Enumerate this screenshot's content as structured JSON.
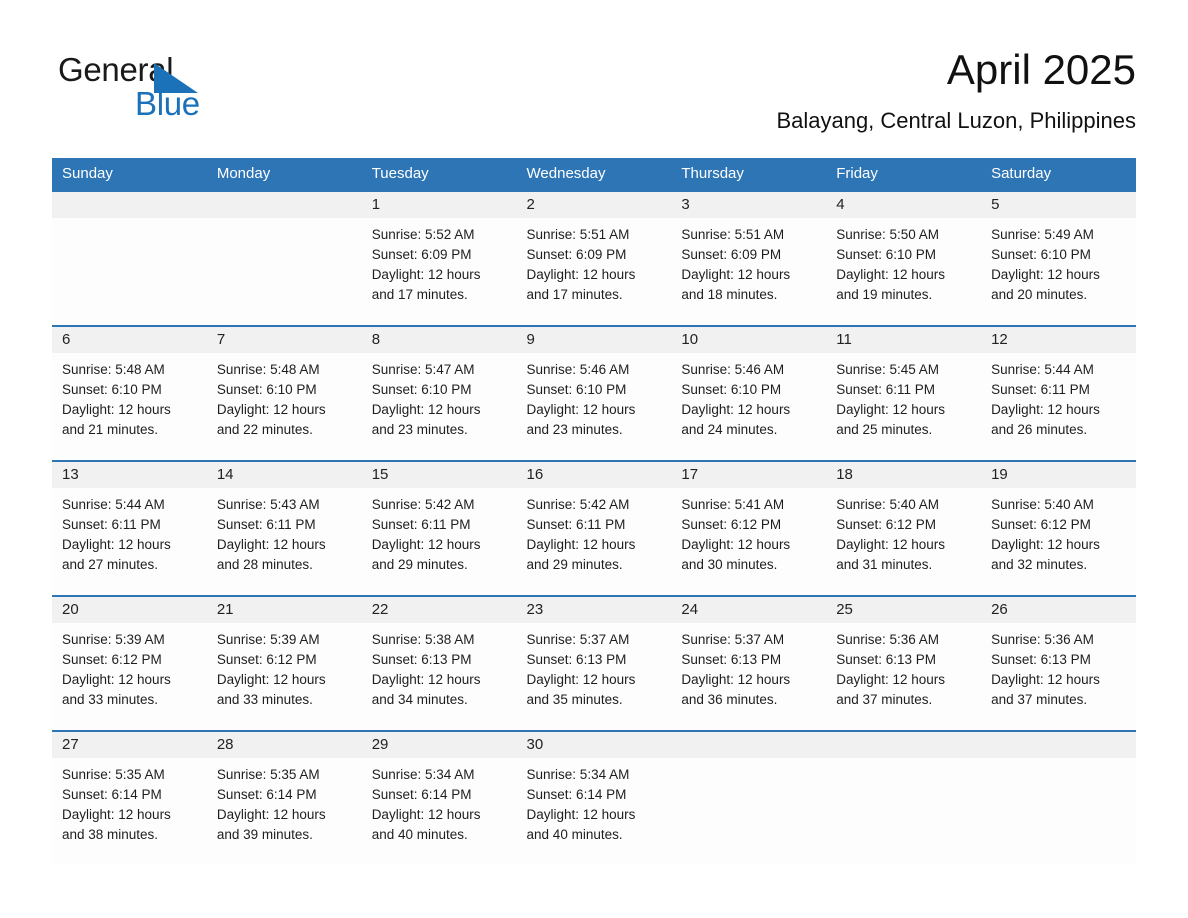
{
  "brand": {
    "name_part1": "General",
    "name_part2": "Blue",
    "triangle_color": "#1b72b8",
    "text_color": "#1a1a1a"
  },
  "header": {
    "title": "April 2025",
    "subtitle": "Balayang, Central Luzon, Philippines"
  },
  "theme": {
    "header_bg": "#2e75b6",
    "header_text": "#ffffff",
    "daynum_bg": "#f1f1f1",
    "cell_bg": "#fdfdfd",
    "row_border": "#2e75b6"
  },
  "calendar": {
    "weekday_headers": [
      "Sunday",
      "Monday",
      "Tuesday",
      "Wednesday",
      "Thursday",
      "Friday",
      "Saturday"
    ],
    "labels": {
      "sunrise": "Sunrise:",
      "sunset": "Sunset:",
      "daylight": "Daylight:"
    },
    "weeks": [
      [
        {
          "day": "",
          "empty": true
        },
        {
          "day": "",
          "empty": true
        },
        {
          "day": "1",
          "sunrise": "Sunrise: 5:52 AM",
          "sunset": "Sunset: 6:09 PM",
          "daylight_l1": "Daylight: 12 hours",
          "daylight_l2": "and 17 minutes."
        },
        {
          "day": "2",
          "sunrise": "Sunrise: 5:51 AM",
          "sunset": "Sunset: 6:09 PM",
          "daylight_l1": "Daylight: 12 hours",
          "daylight_l2": "and 17 minutes."
        },
        {
          "day": "3",
          "sunrise": "Sunrise: 5:51 AM",
          "sunset": "Sunset: 6:09 PM",
          "daylight_l1": "Daylight: 12 hours",
          "daylight_l2": "and 18 minutes."
        },
        {
          "day": "4",
          "sunrise": "Sunrise: 5:50 AM",
          "sunset": "Sunset: 6:10 PM",
          "daylight_l1": "Daylight: 12 hours",
          "daylight_l2": "and 19 minutes."
        },
        {
          "day": "5",
          "sunrise": "Sunrise: 5:49 AM",
          "sunset": "Sunset: 6:10 PM",
          "daylight_l1": "Daylight: 12 hours",
          "daylight_l2": "and 20 minutes."
        }
      ],
      [
        {
          "day": "6",
          "sunrise": "Sunrise: 5:48 AM",
          "sunset": "Sunset: 6:10 PM",
          "daylight_l1": "Daylight: 12 hours",
          "daylight_l2": "and 21 minutes."
        },
        {
          "day": "7",
          "sunrise": "Sunrise: 5:48 AM",
          "sunset": "Sunset: 6:10 PM",
          "daylight_l1": "Daylight: 12 hours",
          "daylight_l2": "and 22 minutes."
        },
        {
          "day": "8",
          "sunrise": "Sunrise: 5:47 AM",
          "sunset": "Sunset: 6:10 PM",
          "daylight_l1": "Daylight: 12 hours",
          "daylight_l2": "and 23 minutes."
        },
        {
          "day": "9",
          "sunrise": "Sunrise: 5:46 AM",
          "sunset": "Sunset: 6:10 PM",
          "daylight_l1": "Daylight: 12 hours",
          "daylight_l2": "and 23 minutes."
        },
        {
          "day": "10",
          "sunrise": "Sunrise: 5:46 AM",
          "sunset": "Sunset: 6:10 PM",
          "daylight_l1": "Daylight: 12 hours",
          "daylight_l2": "and 24 minutes."
        },
        {
          "day": "11",
          "sunrise": "Sunrise: 5:45 AM",
          "sunset": "Sunset: 6:11 PM",
          "daylight_l1": "Daylight: 12 hours",
          "daylight_l2": "and 25 minutes."
        },
        {
          "day": "12",
          "sunrise": "Sunrise: 5:44 AM",
          "sunset": "Sunset: 6:11 PM",
          "daylight_l1": "Daylight: 12 hours",
          "daylight_l2": "and 26 minutes."
        }
      ],
      [
        {
          "day": "13",
          "sunrise": "Sunrise: 5:44 AM",
          "sunset": "Sunset: 6:11 PM",
          "daylight_l1": "Daylight: 12 hours",
          "daylight_l2": "and 27 minutes."
        },
        {
          "day": "14",
          "sunrise": "Sunrise: 5:43 AM",
          "sunset": "Sunset: 6:11 PM",
          "daylight_l1": "Daylight: 12 hours",
          "daylight_l2": "and 28 minutes."
        },
        {
          "day": "15",
          "sunrise": "Sunrise: 5:42 AM",
          "sunset": "Sunset: 6:11 PM",
          "daylight_l1": "Daylight: 12 hours",
          "daylight_l2": "and 29 minutes."
        },
        {
          "day": "16",
          "sunrise": "Sunrise: 5:42 AM",
          "sunset": "Sunset: 6:11 PM",
          "daylight_l1": "Daylight: 12 hours",
          "daylight_l2": "and 29 minutes."
        },
        {
          "day": "17",
          "sunrise": "Sunrise: 5:41 AM",
          "sunset": "Sunset: 6:12 PM",
          "daylight_l1": "Daylight: 12 hours",
          "daylight_l2": "and 30 minutes."
        },
        {
          "day": "18",
          "sunrise": "Sunrise: 5:40 AM",
          "sunset": "Sunset: 6:12 PM",
          "daylight_l1": "Daylight: 12 hours",
          "daylight_l2": "and 31 minutes."
        },
        {
          "day": "19",
          "sunrise": "Sunrise: 5:40 AM",
          "sunset": "Sunset: 6:12 PM",
          "daylight_l1": "Daylight: 12 hours",
          "daylight_l2": "and 32 minutes."
        }
      ],
      [
        {
          "day": "20",
          "sunrise": "Sunrise: 5:39 AM",
          "sunset": "Sunset: 6:12 PM",
          "daylight_l1": "Daylight: 12 hours",
          "daylight_l2": "and 33 minutes."
        },
        {
          "day": "21",
          "sunrise": "Sunrise: 5:39 AM",
          "sunset": "Sunset: 6:12 PM",
          "daylight_l1": "Daylight: 12 hours",
          "daylight_l2": "and 33 minutes."
        },
        {
          "day": "22",
          "sunrise": "Sunrise: 5:38 AM",
          "sunset": "Sunset: 6:13 PM",
          "daylight_l1": "Daylight: 12 hours",
          "daylight_l2": "and 34 minutes."
        },
        {
          "day": "23",
          "sunrise": "Sunrise: 5:37 AM",
          "sunset": "Sunset: 6:13 PM",
          "daylight_l1": "Daylight: 12 hours",
          "daylight_l2": "and 35 minutes."
        },
        {
          "day": "24",
          "sunrise": "Sunrise: 5:37 AM",
          "sunset": "Sunset: 6:13 PM",
          "daylight_l1": "Daylight: 12 hours",
          "daylight_l2": "and 36 minutes."
        },
        {
          "day": "25",
          "sunrise": "Sunrise: 5:36 AM",
          "sunset": "Sunset: 6:13 PM",
          "daylight_l1": "Daylight: 12 hours",
          "daylight_l2": "and 37 minutes."
        },
        {
          "day": "26",
          "sunrise": "Sunrise: 5:36 AM",
          "sunset": "Sunset: 6:13 PM",
          "daylight_l1": "Daylight: 12 hours",
          "daylight_l2": "and 37 minutes."
        }
      ],
      [
        {
          "day": "27",
          "sunrise": "Sunrise: 5:35 AM",
          "sunset": "Sunset: 6:14 PM",
          "daylight_l1": "Daylight: 12 hours",
          "daylight_l2": "and 38 minutes."
        },
        {
          "day": "28",
          "sunrise": "Sunrise: 5:35 AM",
          "sunset": "Sunset: 6:14 PM",
          "daylight_l1": "Daylight: 12 hours",
          "daylight_l2": "and 39 minutes."
        },
        {
          "day": "29",
          "sunrise": "Sunrise: 5:34 AM",
          "sunset": "Sunset: 6:14 PM",
          "daylight_l1": "Daylight: 12 hours",
          "daylight_l2": "and 40 minutes."
        },
        {
          "day": "30",
          "sunrise": "Sunrise: 5:34 AM",
          "sunset": "Sunset: 6:14 PM",
          "daylight_l1": "Daylight: 12 hours",
          "daylight_l2": "and 40 minutes."
        },
        {
          "day": "",
          "empty": true
        },
        {
          "day": "",
          "empty": true
        },
        {
          "day": "",
          "empty": true
        }
      ]
    ]
  }
}
